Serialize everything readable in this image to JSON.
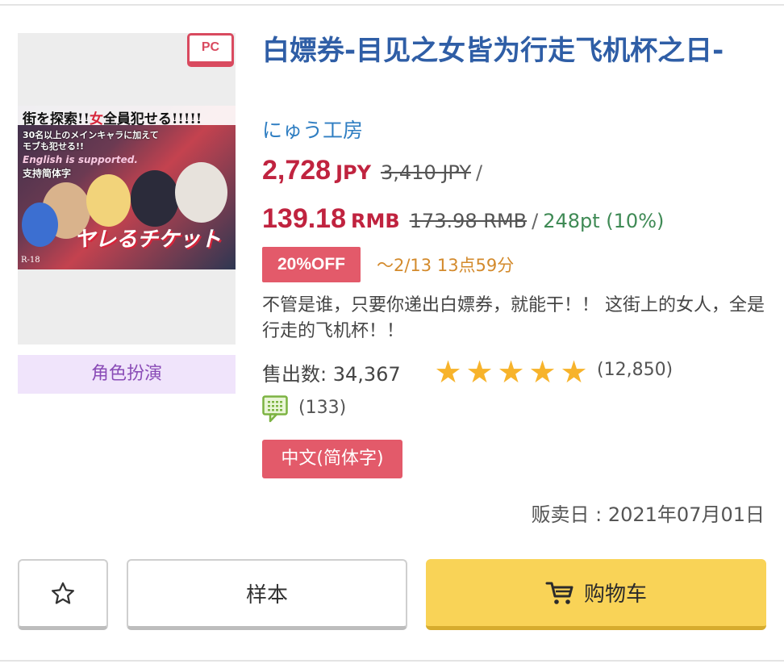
{
  "product": {
    "platform_badge": "PC",
    "genre": "角色扮演",
    "title": "白嫖券-目见之女皆为行走飞机杯之日-",
    "maker": "にゅう工房",
    "price_jpy": "2,728",
    "price_jpy_unit": "JPY",
    "price_jpy_old": "3,410 JPY",
    "price_rmb": "139.18",
    "price_rmb_unit": "RMB",
    "price_rmb_old": "173.98 RMB",
    "slash": "/",
    "points": "248pt (10%)",
    "discount_label": "20%OFF",
    "discount_deadline": "～2/13 13点59分",
    "description": "不管是谁，只要你递出白嫖券，就能干！！ 这街上的女人，全是行走的飞机杯！！",
    "sales_label": "售出数: 34,367",
    "rating_stars": 5,
    "rating_count": "(12,850)",
    "comment_count": "(133)",
    "language_tag": "中文(简体字)",
    "release_date": "贩卖日 : 2021年07月01日"
  },
  "cover": {
    "headline_a": "街を探索!!",
    "headline_red": "女",
    "headline_b": "全員犯せる!!!!!",
    "line1": "30名以上のメインキャラに加えて",
    "line2": "モブも犯せる!!",
    "line3": "English is supported.",
    "line4": "支持简体字",
    "logo": "ヤレるチケット",
    "rating": "R-18"
  },
  "buttons": {
    "favorite_icon": "star-outline-icon",
    "sample_label": "样本",
    "cart_label": "购物车",
    "cart_icon": "cart-icon"
  },
  "colors": {
    "title": "#2f5ea6",
    "price": "#c0233f",
    "discount_bg": "#e35a6a",
    "points": "#3f8a55",
    "star": "#f7b32b",
    "cart_button": "#f9d357",
    "genre_bg": "#f0e4fb"
  }
}
